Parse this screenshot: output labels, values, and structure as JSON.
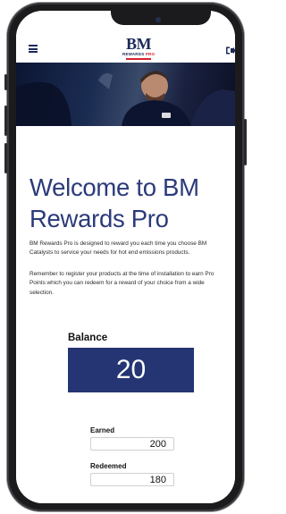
{
  "header": {
    "logo_title": "BM",
    "logo_sub_left": "REWARDS",
    "logo_sub_right": "PRO"
  },
  "hero": {
    "shirt_logo": "BM"
  },
  "main": {
    "title": "Welcome to BM Rewards Pro",
    "intro": "BM Rewards Pro is designed to reward you each time you choose BM Catalysts to service your needs for hot end emissions products.",
    "reminder": "Remember to register your products at the time of installation to earn Pro Points which you can redeem for a reward of your choice from a wide selection."
  },
  "balance": {
    "label": "Balance",
    "value": "20"
  },
  "earned": {
    "label": "Earned",
    "value": "200"
  },
  "redeemed": {
    "label": "Redeemed",
    "value": "180"
  },
  "colors": {
    "brand_navy": "#253573",
    "brand_red": "#d6222f"
  },
  "icons": [
    "menu-icon",
    "logout-icon"
  ]
}
